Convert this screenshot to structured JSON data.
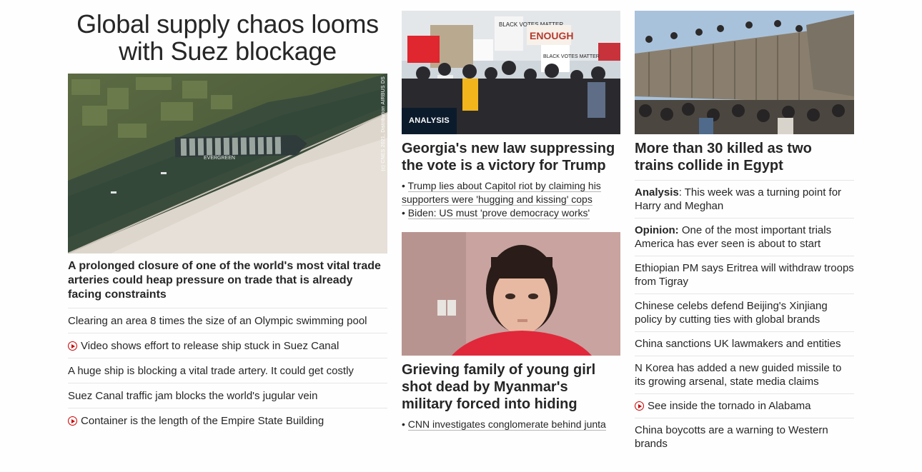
{
  "col1": {
    "headline": "Global supply chaos looms with Suez blockage",
    "image_credit": "(c) CNES 2021, Distribution AIRBUS DS",
    "image_text": "EVERGREEN",
    "lead": "A prolonged closure of one of the world's most vital trade arteries could heap pressure on trade that is already facing constraints",
    "links": [
      {
        "text": "Clearing an area 8 times the size of an Olympic swimming pool",
        "video": false
      },
      {
        "text": "Video shows effort to release ship stuck in Suez Canal",
        "video": true
      },
      {
        "text": "A huge ship is blocking a vital trade artery. It could get costly",
        "video": false
      },
      {
        "text": "Suez Canal traffic jam blocks the world's jugular vein",
        "video": false
      },
      {
        "text": "Container is the length of the Empire State Building",
        "video": true
      }
    ]
  },
  "col2": {
    "story1": {
      "badge": "ANALYSIS",
      "signs": [
        "BLACK VOTES MATTER",
        "ENOUGH",
        "BLACK VOTES MATTER"
      ],
      "title": "Georgia's new law suppressing the vote is a victory for Trump",
      "bullets": [
        "Trump lies about Capitol riot by claiming his supporters were 'hugging and kissing' cops",
        "Biden: US must 'prove democracy works'"
      ]
    },
    "story2": {
      "title": "Grieving family of young girl shot dead by Myanmar's military forced into hiding",
      "bullets": [
        "CNN investigates conglomerate behind junta"
      ]
    }
  },
  "col3": {
    "story": {
      "title": "More than 30 killed as two trains collide in Egypt"
    },
    "links": [
      {
        "prefix": "Analysis",
        "text": ": This week was a turning point for Harry and Meghan",
        "video": false
      },
      {
        "prefix": "Opinion:",
        "text": " One of the most important trials America has ever seen is about to start",
        "video": false
      },
      {
        "prefix": "",
        "text": "Ethiopian PM says Eritrea will withdraw troops from Tigray",
        "video": false
      },
      {
        "prefix": "",
        "text": "Chinese celebs defend Beijing's Xinjiang policy by cutting ties with global brands",
        "video": false
      },
      {
        "prefix": "",
        "text": "China sanctions UK lawmakers and entities",
        "video": false
      },
      {
        "prefix": "",
        "text": "N Korea has added a new guided missile to its growing arsenal, state media claims",
        "video": false
      },
      {
        "prefix": "",
        "text": "See inside the tornado in Alabama",
        "video": true
      },
      {
        "prefix": "",
        "text": "China boycotts are a warning to Western brands",
        "video": false
      }
    ]
  },
  "icons": {
    "video": "play-circle-icon"
  },
  "colors": {
    "accent_red": "#cc0000",
    "badge_bg": "#0c1b2c",
    "text": "#262626",
    "divider": "#e6e6e6"
  }
}
